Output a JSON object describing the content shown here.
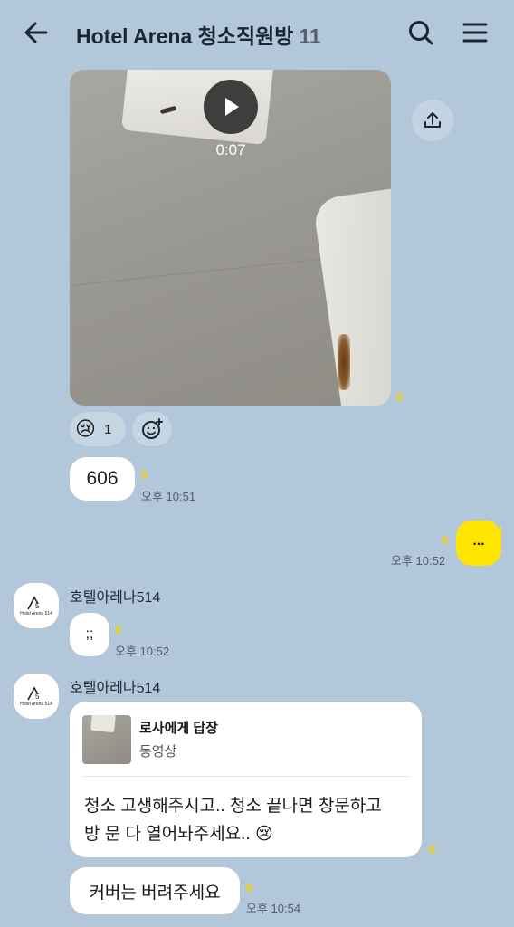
{
  "header": {
    "title": "Hotel Arena 청소직원방",
    "member_count": "11"
  },
  "video": {
    "duration": "0:07",
    "unread": "5"
  },
  "reaction": {
    "emoji": "😢",
    "count": "1"
  },
  "messages": [
    {
      "text": "606",
      "unread": "5",
      "time": "오후 10:51"
    },
    {
      "text": "...",
      "unread": "6",
      "time": "오후 10:52"
    },
    {
      "sender": "호텔아레나514",
      "text": ";;",
      "unread": "6",
      "time": "오후 10:52"
    },
    {
      "sender": "호텔아레나514",
      "reply_title": "로사에게 답장",
      "reply_sub": "동영상",
      "line1": "청소 고생해주시고.. 청소 끝나면 창문하고",
      "line2": "방 문 다 열어놔주세요..",
      "line2_emoji": "😢",
      "unread": "6"
    },
    {
      "text": "커버는 버려주세요",
      "unread": "6",
      "time": "오후 10:54"
    }
  ],
  "avatar": {
    "logo": "AS",
    "caption": "Hotel Arena 514"
  },
  "colors": {
    "background": "#b2c7da",
    "my_bubble": "#fee500",
    "unread_count": "#f1d400"
  },
  "icons": [
    "back-arrow-icon",
    "search-icon",
    "menu-icon",
    "play-icon",
    "share-icon",
    "add-emoji-icon"
  ]
}
